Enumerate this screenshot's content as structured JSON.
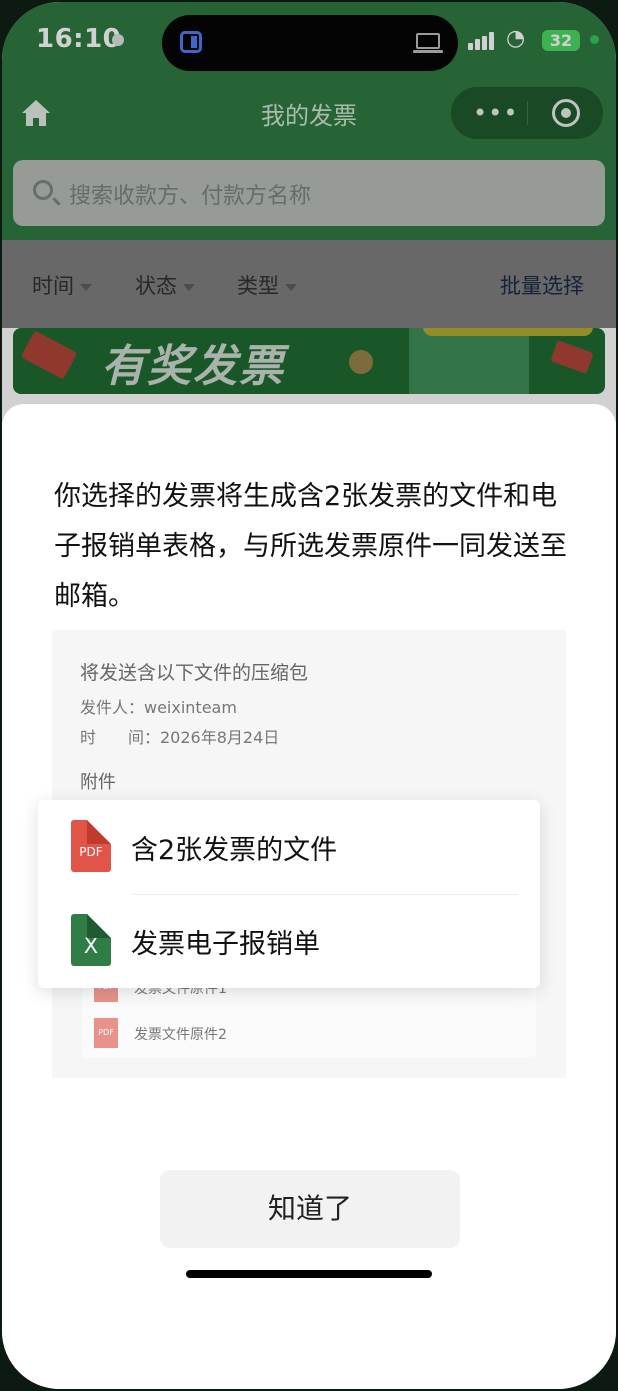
{
  "status_bar": {
    "time": "16:10",
    "battery": "32"
  },
  "nav": {
    "title": "我的发票",
    "more_glyph": "•••"
  },
  "search": {
    "placeholder": "搜索收款方、付款方名称"
  },
  "filters": {
    "time": "时间",
    "status": "状态",
    "type": "类型",
    "batch_select": "批量选择"
  },
  "banner": {
    "text": "有奖发票"
  },
  "sheet": {
    "message": "你选择的发票将生成含2张发票的文件和电子报销单表格，与所选发票原件一同发送至邮箱。",
    "preview": {
      "title": "将发送含以下文件的压缩包",
      "sender": "发件人：weixinteam",
      "time": "时　　间：2026年8月24日",
      "attachments_label": "附件"
    },
    "files": [
      {
        "name": "含2张发票的文件",
        "icon_text": "PDF"
      },
      {
        "name": "发票电子报销单",
        "icon_text": "X"
      }
    ],
    "originals": [
      {
        "name": "发票文件原件1",
        "icon_text": "PDF"
      },
      {
        "name": "发票文件原件2",
        "icon_text": "PDF"
      }
    ],
    "ok_label": "知道了"
  },
  "colors": {
    "brand_green": "#2f7a41",
    "pdf_red": "#e05548",
    "excel_green": "#2f7d45"
  }
}
